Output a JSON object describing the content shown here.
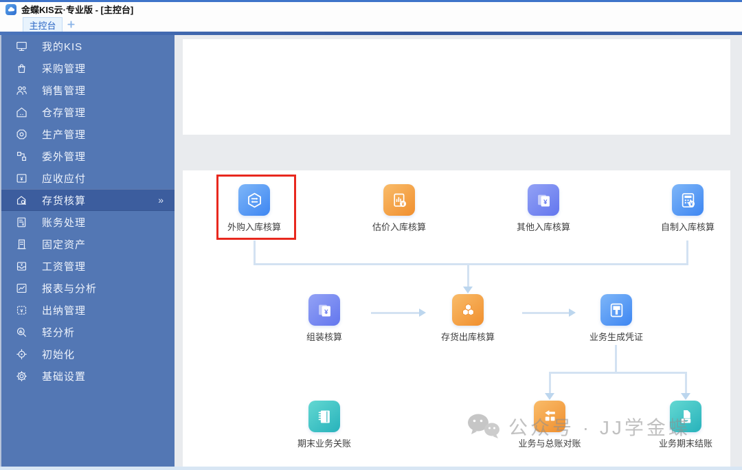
{
  "window": {
    "title": "金蝶KIS云·专业版 - [主控台]"
  },
  "tabbar": {
    "active_tab": "主控台"
  },
  "sidebar": {
    "expand_chevron": "»",
    "selected_index": 7,
    "items": [
      {
        "label": "我的KIS",
        "icon": "monitor-icon"
      },
      {
        "label": "采购管理",
        "icon": "shopping-bag-icon"
      },
      {
        "label": "销售管理",
        "icon": "people-icon"
      },
      {
        "label": "仓存管理",
        "icon": "warehouse-icon"
      },
      {
        "label": "生产管理",
        "icon": "production-icon"
      },
      {
        "label": "委外管理",
        "icon": "outsourcing-icon"
      },
      {
        "label": "应收应付",
        "icon": "receivable-payable-icon"
      },
      {
        "label": "存货核算",
        "icon": "inventory-accounting-icon"
      },
      {
        "label": "账务处理",
        "icon": "bookkeeping-icon"
      },
      {
        "label": "固定资产",
        "icon": "fixed-assets-icon"
      },
      {
        "label": "工资管理",
        "icon": "payroll-icon"
      },
      {
        "label": "报表与分析",
        "icon": "report-analysis-icon"
      },
      {
        "label": "出纳管理",
        "icon": "cashier-icon"
      },
      {
        "label": "轻分析",
        "icon": "light-analysis-icon"
      },
      {
        "label": "初始化",
        "icon": "initialization-icon"
      },
      {
        "label": "基础设置",
        "icon": "settings-icon"
      }
    ]
  },
  "flowchart": {
    "highlighted_node": "外购入库核算",
    "highlight_color": "#e8281e",
    "nodes": [
      {
        "label": "外购入库核算",
        "color": "#3d86f2",
        "icon": "swap-hexagon-icon"
      },
      {
        "label": "估价入库核算",
        "color": "#f08f2e",
        "icon": "estimate-doc-icon"
      },
      {
        "label": "其他入库核算",
        "color": "#6276ee",
        "icon": "pages-yen-icon"
      },
      {
        "label": "自制入库核算",
        "color": "#3d86f2",
        "icon": "calculator-icon"
      },
      {
        "label": "组装核算",
        "color": "#6276ee",
        "icon": "pages-yen-icon"
      },
      {
        "label": "存货出库核算",
        "color": "#f08f2e",
        "icon": "cubes-icon"
      },
      {
        "label": "业务生成凭证",
        "color": "#3d86f2",
        "icon": "voucher-icon"
      },
      {
        "label": "期末业务关账",
        "color": "#27b2bb",
        "icon": "notebook-icon"
      },
      {
        "label": "业务与总账对账",
        "color": "#f08f2e",
        "icon": "reconcile-icon"
      },
      {
        "label": "业务期末结账",
        "color": "#27b2bb",
        "icon": "period-close-icon"
      }
    ]
  },
  "watermark": {
    "text": "公众号 · JJ学金蝶"
  },
  "colors": {
    "sidebar_bg": "#5377b4",
    "sidebar_selected_bg": "#3c5d9e",
    "topbar_blue": "#3d65ac",
    "workspace_bg": "#e9ebee",
    "connector": "#d3e2f2",
    "tab_bg": "#e8f3fd",
    "tab_text": "#2a66c4"
  }
}
